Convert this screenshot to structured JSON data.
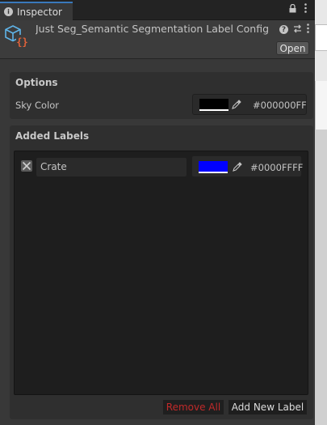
{
  "tab": {
    "label": "Inspector",
    "icon": "info-icon"
  },
  "header": {
    "title": "Just Seg_Semantic Segmentation Label Config",
    "open_label": "Open"
  },
  "options": {
    "title": "Options",
    "sky_color_label": "Sky Color",
    "sky_color_value": "#000000",
    "sky_color_hex": "#000000FF"
  },
  "labels": {
    "title": "Added Labels",
    "items": [
      {
        "name": "Crate",
        "color": "#0000FF",
        "hex": "#0000FFFF"
      }
    ],
    "remove_all_label": "Remove All",
    "add_new_label": "Add New Label"
  },
  "colors": {
    "accent": "#3A79BB",
    "danger": "#C02A2A",
    "panel": "#2F2F2F",
    "background": "#383838"
  }
}
